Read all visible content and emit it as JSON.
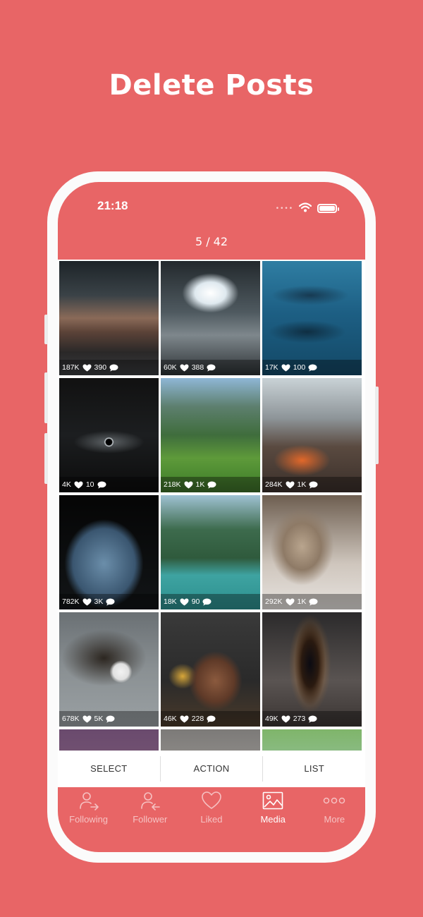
{
  "headline": "Delete Posts",
  "status_bar": {
    "time": "21:18",
    "dots": "••••"
  },
  "header": {
    "counter": "5 / 42"
  },
  "posts": [
    {
      "views": "187K",
      "likes": "390"
    },
    {
      "views": "60K",
      "likes": "388"
    },
    {
      "views": "17K",
      "likes": "100"
    },
    {
      "views": "4K",
      "likes": "10"
    },
    {
      "views": "218K",
      "likes": "1K"
    },
    {
      "views": "284K",
      "likes": "1K"
    },
    {
      "views": "782K",
      "likes": "3K"
    },
    {
      "views": "18K",
      "likes": "90"
    },
    {
      "views": "292K",
      "likes": "1K"
    },
    {
      "views": "678K",
      "likes": "5K"
    },
    {
      "views": "46K",
      "likes": "228"
    },
    {
      "views": "49K",
      "likes": "273"
    }
  ],
  "toolbar": {
    "select": "SELECT",
    "action": "ACTION",
    "list": "LIST"
  },
  "tabs": [
    {
      "label": "Following",
      "icon": "user-arrow-right-icon",
      "active": false
    },
    {
      "label": "Follower",
      "icon": "user-arrow-left-icon",
      "active": false
    },
    {
      "label": "Liked",
      "icon": "heart-icon",
      "active": false
    },
    {
      "label": "Media",
      "icon": "image-icon",
      "active": true
    },
    {
      "label": "More",
      "icon": "more-dots-icon",
      "active": false
    }
  ],
  "colors": {
    "background": "#e86566",
    "phone_frame": "#fbfbfb",
    "text": "#ffffff"
  }
}
